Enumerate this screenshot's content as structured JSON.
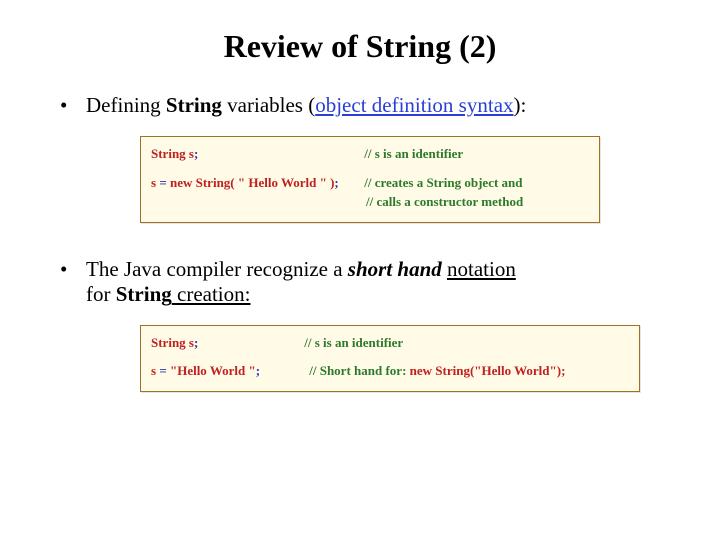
{
  "title": "Review of String (2)",
  "bullet1": {
    "prefix": "Defining ",
    "bold_word": "String",
    "mid": " variables (",
    "link_text": "object definition syntax",
    "suffix": "):"
  },
  "code1": {
    "l1_kw": "String s",
    "l1_semi": ";",
    "l1_cm": "// s is an identifier",
    "l2_lhs_var": "s ",
    "l2_eq": "= ",
    "l2_new": "new String( \" Hello World \" )",
    "l2_semi": ";",
    "l2_cm_a": "// creates a String object and",
    "l2_cm_b": "// calls a constructor method"
  },
  "bullet2": {
    "prefix": "The Java compiler recognize a ",
    "em_word": "short hand",
    "mid": " ",
    "ul_word": "notation",
    "line2_pre": "for ",
    "line2_bold": "String",
    "line2_suf": " creation:"
  },
  "code2": {
    "l1_kw": "String s",
    "l1_semi": ";",
    "l1_cm": "// s is an identifier",
    "l2_var": "s ",
    "l2_eq": "= ",
    "l2_str": "\"Hello World \"",
    "l2_semi": ";",
    "l2_cm_pre": "// Short hand for: ",
    "l2_cm_code": "new String(\"Hello World\");"
  },
  "colors": {
    "link": "#2a3ed6",
    "keyword": "#c02020",
    "comment": "#2c7a2c",
    "punct": "#2a30b0",
    "box_border": "#a07028",
    "box_bg": "#fffbe7"
  }
}
